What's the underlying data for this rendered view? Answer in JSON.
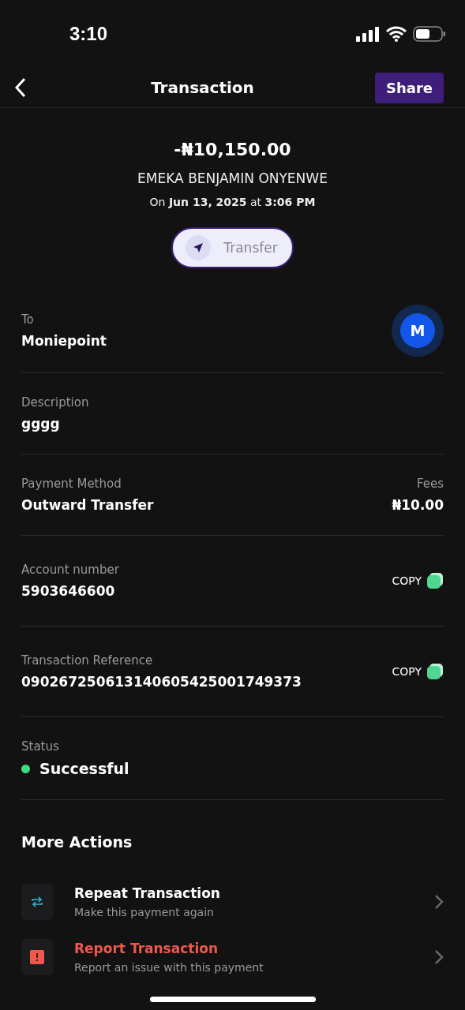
{
  "status_bar": {
    "time": "3:10"
  },
  "header": {
    "title": "Transaction",
    "share": "Share"
  },
  "summary": {
    "amount": "-₦10,150.00",
    "name": "EMEKA BENJAMIN ONYENWE",
    "date": "On **Jun 13, 2025** at **3:06 PM**",
    "type": "Transfer"
  },
  "details": [
    {
      "kind": "avatar",
      "label": "To",
      "value": "Moniepoint",
      "avatar": "M"
    },
    {
      "kind": "plain",
      "label": "Description",
      "value": "gggg"
    },
    {
      "kind": "fees",
      "label": "Payment Method",
      "value": "Outward Transfer",
      "side_label": "Fees",
      "side_value": "₦10.00"
    },
    {
      "kind": "copy",
      "label": "Account number",
      "value": "5903646600",
      "action": "COPY"
    },
    {
      "kind": "copy",
      "label": "Transaction Reference",
      "value": "090267250613140605425001749373",
      "action": "COPY"
    },
    {
      "kind": "status",
      "label": "Status",
      "value": "Successful",
      "color": "#3ddc84"
    }
  ],
  "more_actions": {
    "title": "More Actions",
    "items": [
      {
        "kind": "repeat",
        "title": "Repeat Transaction",
        "subtitle": "Make this payment again"
      },
      {
        "kind": "report",
        "title": "Report Transaction",
        "subtitle": "Report an issue with this payment"
      }
    ]
  }
}
